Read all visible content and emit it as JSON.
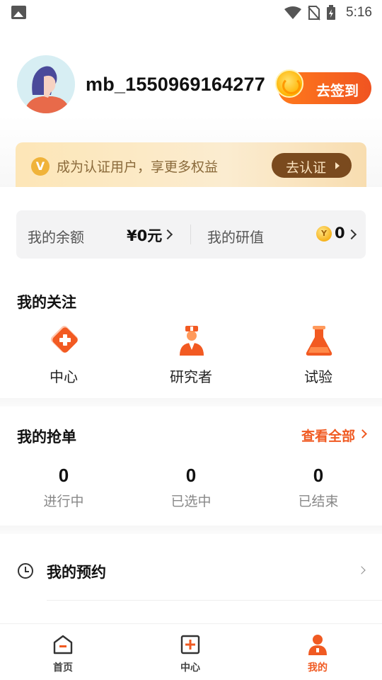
{
  "status_bar": {
    "time": "5:16"
  },
  "profile": {
    "username": "mb_1550969164277",
    "signin_label": "去签到"
  },
  "verify_banner": {
    "text": "成为认证用户，享更多权益",
    "button_label": "去认证",
    "icon_letter": "V"
  },
  "wallet": {
    "balance_label": "我的余额",
    "balance_value": "¥0元",
    "research_label": "我的研值",
    "research_value": "0",
    "coin_letter": "Y"
  },
  "follow": {
    "title": "我的关注",
    "items": [
      {
        "label": "中心",
        "icon": "center-cross-icon"
      },
      {
        "label": "研究者",
        "icon": "doctor-icon"
      },
      {
        "label": "试验",
        "icon": "flask-icon"
      }
    ]
  },
  "orders": {
    "title": "我的抢单",
    "see_all": "查看全部",
    "stats": [
      {
        "value": "0",
        "label": "进行中"
      },
      {
        "value": "0",
        "label": "已选中"
      },
      {
        "value": "0",
        "label": "已结束"
      }
    ]
  },
  "appointments": {
    "label": "我的预约"
  },
  "tabbar": {
    "items": [
      {
        "label": "首页",
        "icon": "home-icon",
        "active": false
      },
      {
        "label": "中心",
        "icon": "center-icon",
        "active": false
      },
      {
        "label": "我的",
        "icon": "profile-icon",
        "active": true
      }
    ]
  },
  "colors": {
    "accent": "#f05a22",
    "banner_bg": "#fbe8c4",
    "banner_button": "#7a4a1e"
  }
}
